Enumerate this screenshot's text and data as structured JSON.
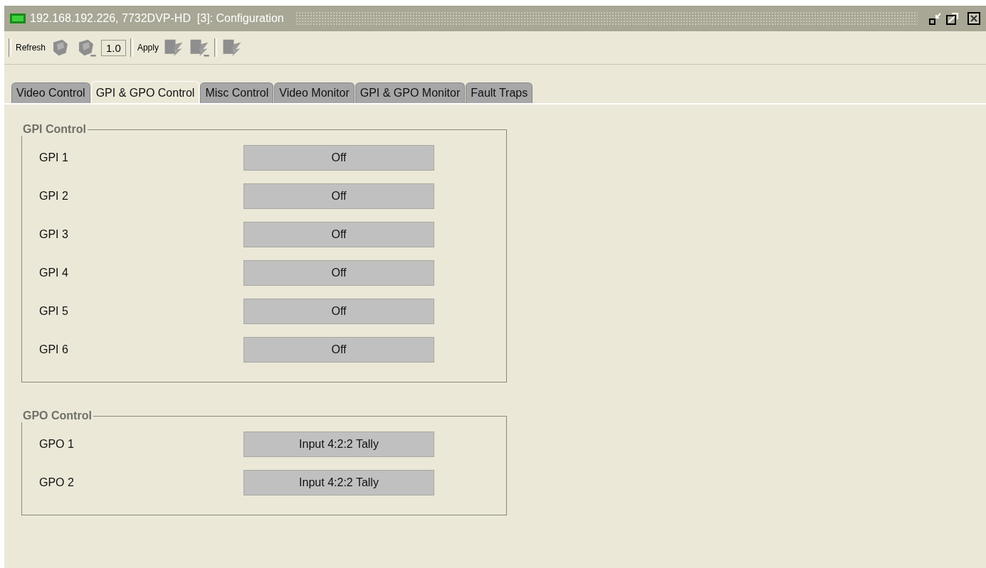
{
  "window": {
    "title": "192.168.192.226, 7732DVP-HD  [3]: Configuration"
  },
  "toolbar": {
    "refresh_label": "Refresh",
    "version": "1.0",
    "apply_label": "Apply"
  },
  "tabs": [
    {
      "label": "Video Control",
      "selected": false
    },
    {
      "label": "GPI & GPO Control",
      "selected": true
    },
    {
      "label": "Misc Control",
      "selected": false
    },
    {
      "label": "Video Monitor",
      "selected": false
    },
    {
      "label": "GPI & GPO Monitor",
      "selected": false
    },
    {
      "label": "Fault Traps",
      "selected": false
    }
  ],
  "groups": [
    {
      "title": "GPI Control",
      "rows": [
        {
          "label": "GPI 1",
          "value": "Off"
        },
        {
          "label": "GPI 2",
          "value": "Off"
        },
        {
          "label": "GPI 3",
          "value": "Off"
        },
        {
          "label": "GPI 4",
          "value": "Off"
        },
        {
          "label": "GPI 5",
          "value": "Off"
        },
        {
          "label": "GPI 6",
          "value": "Off"
        }
      ]
    },
    {
      "title": "GPO Control",
      "rows": [
        {
          "label": "GPO 1",
          "value": "Input 4:2:2 Tally"
        },
        {
          "label": "GPO 2",
          "value": "Input 4:2:2 Tally"
        }
      ]
    }
  ]
}
